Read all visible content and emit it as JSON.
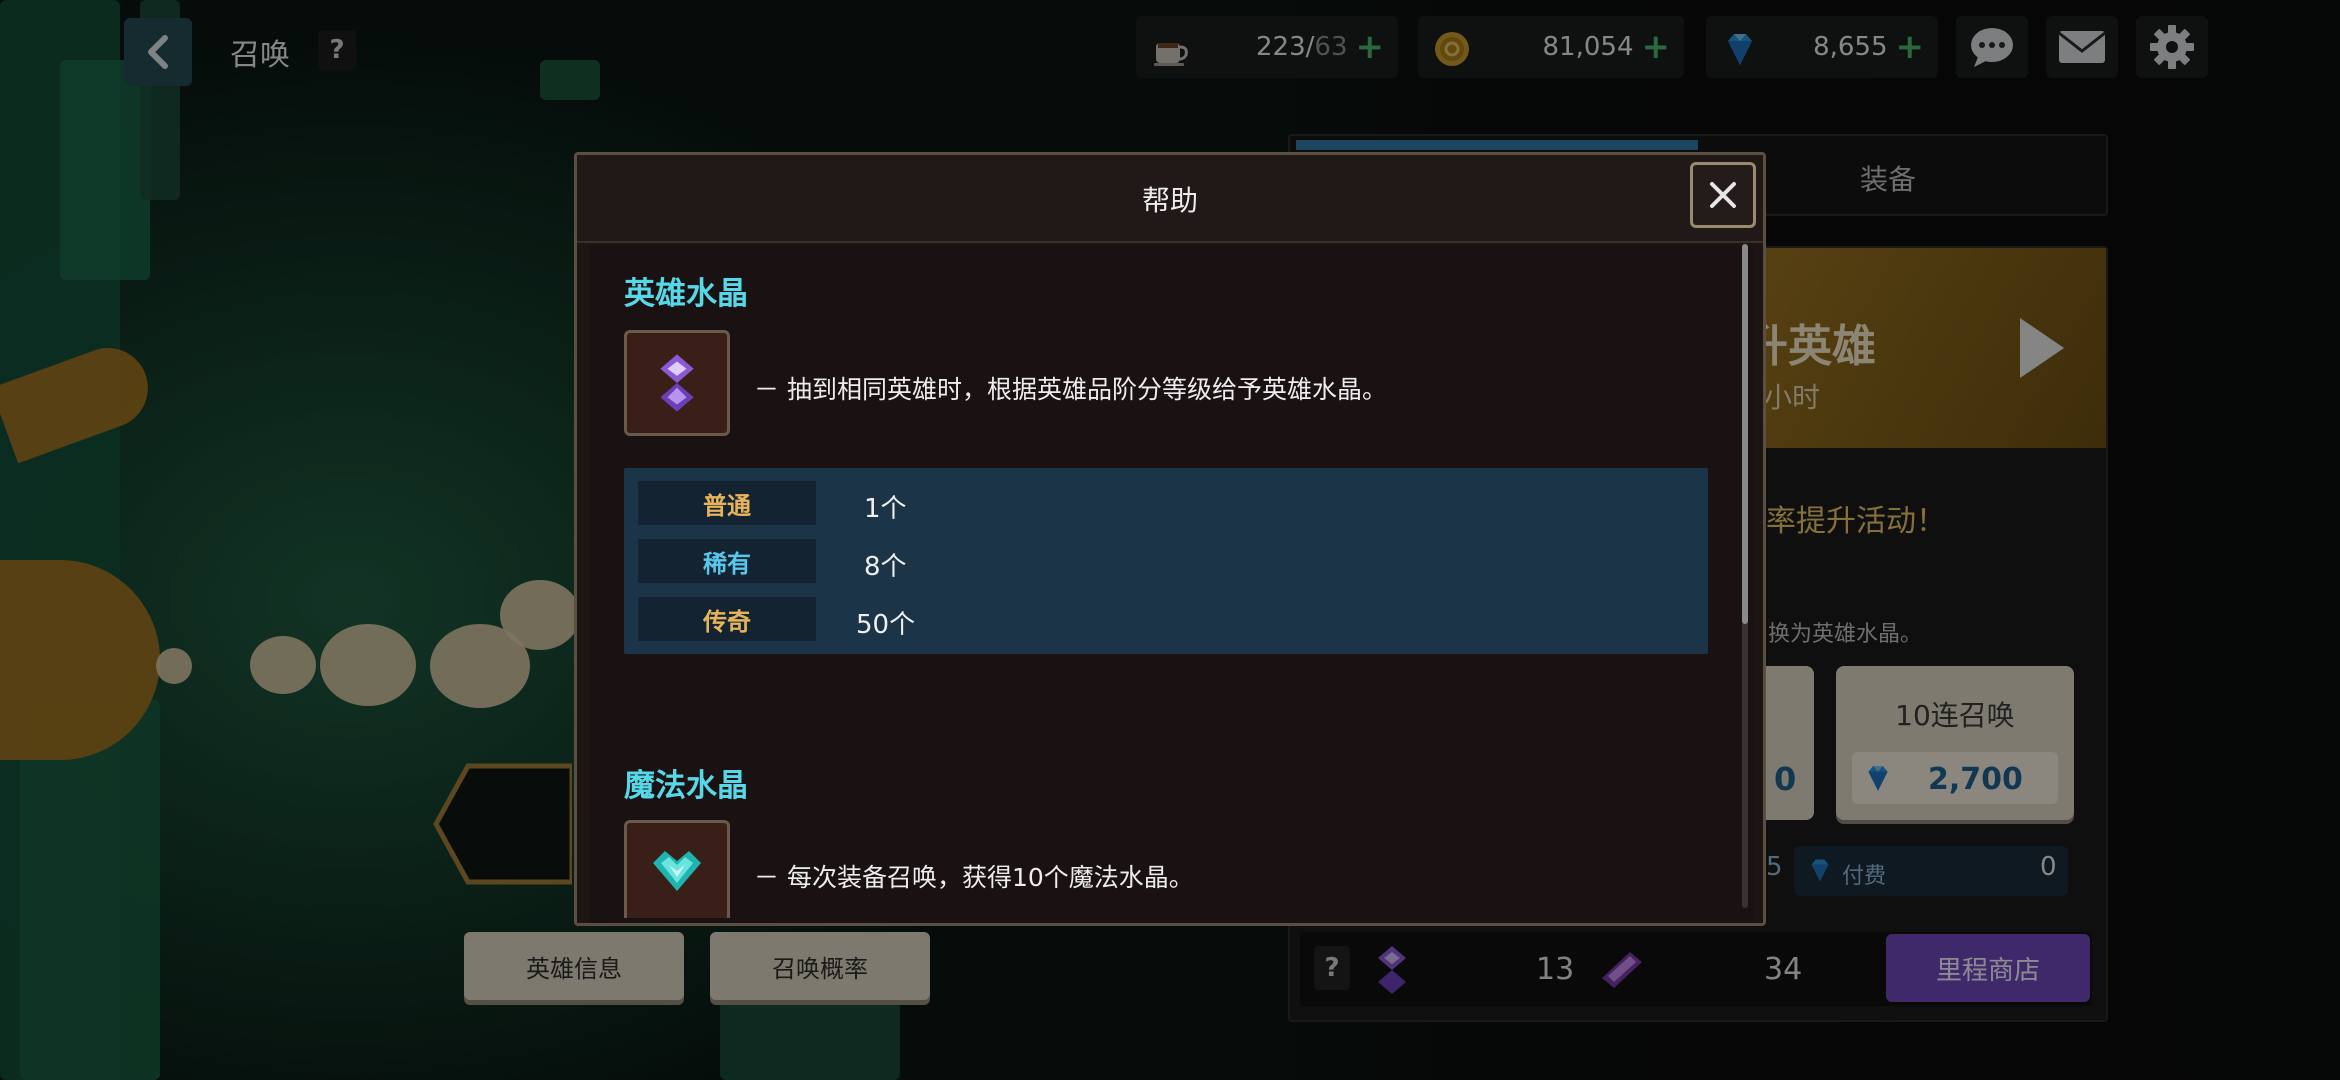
{
  "top_bar": {
    "title": "召唤",
    "help_label": "?",
    "coffee_value": "223/",
    "coffee_max": "63",
    "gold_value": "81,054",
    "gem_value": "8,655",
    "plus": "+"
  },
  "right_panel": {
    "tab_equipment": "装备",
    "banner_title": "升英雄",
    "banner_sub": "小时",
    "event_text": "率提升活动！",
    "note_text": "换为英雄水晶。",
    "card_left_price": "0",
    "summon10_title": "10连召唤",
    "summon10_price": "2,700",
    "paid_left": "5",
    "paid_label": "付费",
    "paid_value": "0",
    "help_label": "?",
    "crystal_count": "13",
    "ticket_count": "34",
    "milestone_shop": "里程商店"
  },
  "left_buttons": {
    "hero_info": "英雄信息",
    "summon_rate": "召唤概率"
  },
  "modal": {
    "title": "帮助",
    "hero_crystal": {
      "title": "英雄水晶",
      "description": "－ 抽到相同英雄时，根据英雄品阶分等级给予英雄水晶。",
      "grades": [
        {
          "label": "普通",
          "value": "1个",
          "color": "#e6b45a"
        },
        {
          "label": "稀有",
          "value": "8个",
          "color": "#56c8ec"
        },
        {
          "label": "传奇",
          "value": "50个",
          "color": "#e6b45a"
        }
      ]
    },
    "magic_crystal": {
      "title": "魔法水晶",
      "description": "－ 每次装备召唤，获得10个魔法水晶。"
    }
  },
  "colors": {
    "accent_cyan": "#56d8e8",
    "gold_grade": "#e6b45a",
    "rare_grade": "#56c8ec",
    "shop_purple": "#6d48b8",
    "plus_green": "#49b36b"
  },
  "icons": [
    "back-arrow-icon",
    "coffee-icon",
    "coin-icon",
    "gem-icon",
    "chat-icon",
    "mail-icon",
    "gear-icon",
    "close-icon",
    "hero-crystal-icon",
    "magic-crystal-icon",
    "ticket-icon",
    "play-icon"
  ]
}
